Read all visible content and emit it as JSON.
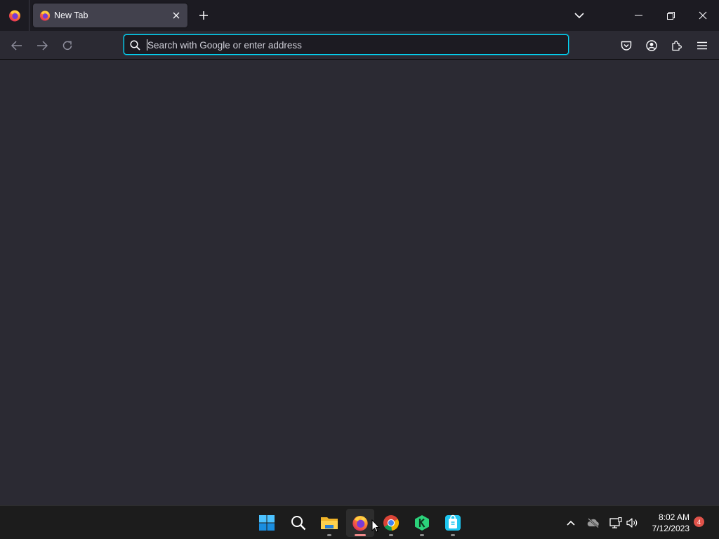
{
  "browser": {
    "tabs": [
      {
        "title": "New Tab",
        "active": true
      }
    ],
    "urlbar": {
      "placeholder": "Search with Google or enter address",
      "value": ""
    }
  },
  "taskbar": {
    "apps": [
      {
        "name": "Start"
      },
      {
        "name": "Search"
      },
      {
        "name": "File Explorer"
      },
      {
        "name": "Firefox"
      },
      {
        "name": "Google Chrome"
      },
      {
        "name": "K app"
      },
      {
        "name": "Store app"
      }
    ],
    "clock": {
      "time": "8:02 AM",
      "date": "7/12/2023"
    },
    "notification_count": "4"
  },
  "colors": {
    "accent_focus": "#00ddff",
    "chrome_bg": "#1c1b22",
    "toolbar_bg": "#2b2a33",
    "tab_active_bg": "#42414d"
  }
}
